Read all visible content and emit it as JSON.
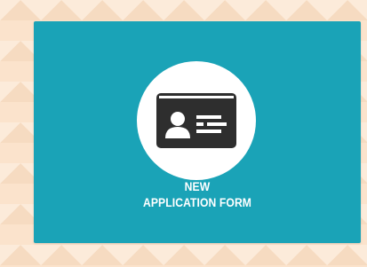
{
  "tile": {
    "icon": "id-card-icon",
    "label_line1": "NEW",
    "label_line2": "APPLICATION FORM",
    "colors": {
      "tile_background": "#1aa3b7",
      "icon_circle": "#ffffff",
      "icon_card": "#2e2e2e",
      "label_text": "#ffffff",
      "page_background": "#fbe3cc"
    }
  }
}
